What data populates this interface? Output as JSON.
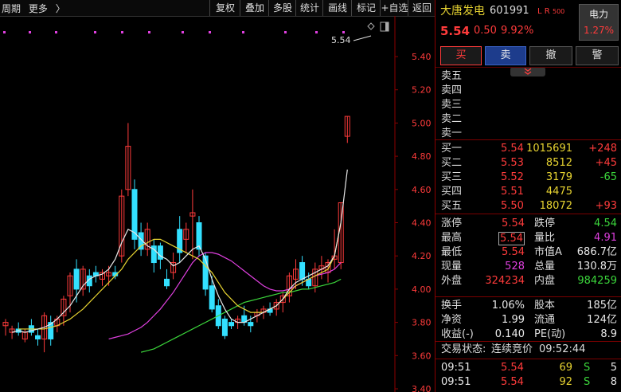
{
  "toolbar": {
    "period": "周期",
    "more": "更多",
    "more_arrow": "〉",
    "buttons": [
      "复权",
      "叠加",
      "多股",
      "统计",
      "画线",
      "标记",
      "+自选",
      "返回"
    ]
  },
  "chart_data": {
    "type": "candlestick",
    "ylim": [
      3.4,
      5.6
    ],
    "yticks": [
      "5.40",
      "5.20",
      "5.00",
      "4.80",
      "4.60",
      "4.40",
      "4.20",
      "4.00",
      "3.80",
      "3.60",
      "3.40"
    ],
    "annotation": "5.54",
    "candles": [
      [
        3.78,
        3.82,
        3.72,
        3.8
      ],
      [
        3.74,
        3.78,
        3.7,
        3.76
      ],
      [
        3.76,
        3.8,
        3.72,
        3.74
      ],
      [
        3.7,
        3.76,
        3.68,
        3.74
      ],
      [
        3.78,
        3.82,
        3.72,
        3.74
      ],
      [
        3.72,
        3.76,
        3.66,
        3.7
      ],
      [
        3.7,
        3.86,
        3.62,
        3.84
      ],
      [
        3.8,
        3.84,
        3.66,
        3.7
      ],
      [
        3.78,
        3.84,
        3.74,
        3.82
      ],
      [
        3.84,
        3.96,
        3.78,
        3.94
      ],
      [
        3.96,
        4.1,
        3.86,
        4.08
      ],
      [
        4.12,
        4.18,
        3.92,
        4.0
      ],
      [
        4.0,
        4.14,
        3.96,
        4.12
      ],
      [
        4.08,
        4.12,
        3.98,
        4.02
      ],
      [
        4.1,
        4.14,
        4.04,
        4.08
      ],
      [
        4.06,
        4.12,
        4.02,
        4.1
      ],
      [
        4.08,
        4.14,
        4.02,
        4.1
      ],
      [
        4.1,
        4.14,
        4.06,
        4.08
      ],
      [
        4.2,
        4.6,
        4.16,
        4.56
      ],
      [
        4.6,
        5.0,
        4.56,
        4.86
      ],
      [
        4.6,
        4.66,
        4.24,
        4.3
      ],
      [
        4.34,
        4.4,
        4.2,
        4.24
      ],
      [
        4.24,
        4.4,
        4.2,
        4.36
      ],
      [
        4.26,
        4.3,
        4.1,
        4.16
      ],
      [
        4.26,
        4.28,
        4.12,
        4.18
      ],
      [
        4.06,
        4.12,
        4.0,
        4.02
      ],
      [
        4.1,
        4.22,
        4.06,
        4.16
      ],
      [
        4.36,
        4.44,
        4.16,
        4.22
      ],
      [
        4.3,
        4.4,
        4.22,
        4.36
      ],
      [
        4.44,
        4.6,
        4.18,
        4.46
      ],
      [
        4.4,
        4.44,
        4.2,
        4.24
      ],
      [
        4.2,
        4.22,
        3.96,
        4.0
      ],
      [
        4.02,
        4.08,
        3.86,
        3.88
      ],
      [
        3.9,
        3.94,
        3.76,
        3.78
      ],
      [
        3.82,
        3.84,
        3.7,
        3.72
      ],
      [
        3.8,
        3.82,
        3.76,
        3.78
      ],
      [
        3.8,
        3.84,
        3.76,
        3.82
      ],
      [
        3.84,
        3.9,
        3.78,
        3.8
      ],
      [
        3.8,
        3.84,
        3.74,
        3.78
      ],
      [
        3.84,
        3.88,
        3.8,
        3.86
      ],
      [
        3.86,
        3.9,
        3.82,
        3.88
      ],
      [
        3.88,
        3.92,
        3.84,
        3.86
      ],
      [
        3.88,
        3.94,
        3.84,
        3.92
      ],
      [
        3.92,
        3.98,
        3.86,
        3.96
      ],
      [
        3.96,
        4.1,
        3.92,
        4.08
      ],
      [
        4.06,
        4.18,
        4.0,
        4.12
      ],
      [
        4.16,
        4.2,
        4.02,
        4.06
      ],
      [
        4.06,
        4.1,
        4.0,
        4.02
      ],
      [
        4.02,
        4.16,
        3.98,
        4.12
      ],
      [
        4.12,
        4.2,
        4.06,
        4.14
      ],
      [
        4.1,
        4.18,
        4.04,
        4.16
      ],
      [
        4.18,
        4.36,
        4.12,
        4.2
      ],
      [
        4.16,
        4.52,
        4.12,
        4.52
      ],
      [
        4.92,
        5.04,
        4.88,
        5.04
      ]
    ],
    "ma_white": [
      3.74,
      3.75,
      3.74,
      3.75,
      3.76,
      3.77,
      3.79,
      3.82,
      3.86,
      3.9,
      3.96,
      4.02,
      4.06,
      4.08,
      4.09,
      4.12,
      4.18,
      4.28,
      4.36,
      4.34,
      4.3,
      4.26,
      4.24,
      4.2,
      4.18,
      4.14,
      4.16,
      4.2,
      4.24,
      4.26,
      4.18,
      4.06,
      3.96,
      3.88,
      3.82,
      3.8,
      3.8,
      3.82,
      3.84,
      3.86,
      3.88,
      3.9,
      3.94,
      4.0,
      4.04,
      4.06,
      4.08,
      4.1,
      4.12,
      4.14,
      4.2,
      4.4,
      4.72
    ],
    "ma_yellow": [
      3.76,
      3.76,
      3.76,
      3.76,
      3.76,
      3.77,
      3.78,
      3.8,
      3.82,
      3.85,
      3.88,
      3.92,
      3.96,
      4.0,
      4.04,
      4.08,
      4.12,
      4.18,
      4.22,
      4.26,
      4.28,
      4.3,
      4.3,
      4.28,
      4.26,
      4.24,
      4.22,
      4.2,
      4.18,
      4.14,
      4.1,
      4.04,
      3.98,
      3.94,
      3.9,
      3.88,
      3.86,
      3.86,
      3.86,
      3.88,
      3.9,
      3.94,
      3.98,
      4.02,
      4.04,
      4.06,
      4.08,
      4.1,
      4.12,
      4.2,
      4.4
    ],
    "ma_magenta": [
      3.7,
      3.71,
      3.72,
      3.73,
      3.75,
      3.77,
      3.8,
      3.84,
      3.88,
      3.93,
      3.98,
      4.04,
      4.1,
      4.16,
      4.2,
      4.22,
      4.22,
      4.21,
      4.19,
      4.17,
      4.14,
      4.11,
      4.08,
      4.05,
      4.02,
      4.0,
      3.99,
      3.99,
      4.0,
      4.02,
      4.04,
      4.06,
      4.08,
      4.09,
      4.1,
      4.12,
      4.16
    ],
    "ma_green": [
      3.62,
      3.63,
      3.64,
      3.66,
      3.68,
      3.7,
      3.72,
      3.74,
      3.76,
      3.78,
      3.8,
      3.82,
      3.84,
      3.86,
      3.88,
      3.9,
      3.92,
      3.93,
      3.94,
      3.95,
      3.96,
      3.97,
      3.98,
      3.98,
      3.99,
      4.0,
      4.0,
      4.01,
      4.02,
      4.03,
      4.04,
      4.06
    ]
  },
  "stock": {
    "name": "大唐发电",
    "code": "601991",
    "tags": "L R",
    "tag_small": "500",
    "price": "5.54",
    "change": "0.50",
    "pct": "9.92%",
    "sector": "电力",
    "sector_pct": "1.27%"
  },
  "actions": {
    "buy": "买",
    "sell": "卖",
    "cancel": "撤",
    "alert": "警"
  },
  "collapse_icon": "chevron-double-down",
  "sell_levels": [
    "卖五",
    "卖四",
    "卖三",
    "卖二",
    "卖一"
  ],
  "buy_levels": [
    {
      "label": "买一",
      "price": "5.54",
      "vol": "1015691",
      "chg": "+248"
    },
    {
      "label": "买二",
      "price": "5.53",
      "vol": "8512",
      "chg": "+45"
    },
    {
      "label": "买三",
      "price": "5.52",
      "vol": "3179",
      "chg": "-65"
    },
    {
      "label": "买四",
      "price": "5.51",
      "vol": "4475",
      "chg": ""
    },
    {
      "label": "买五",
      "price": "5.50",
      "vol": "18072",
      "chg": "+93"
    }
  ],
  "stats": [
    {
      "l1": "涨停",
      "v1": "5.54",
      "l2": "跌停",
      "v2": "4.54"
    },
    {
      "l1": "最高",
      "v1": "5.54",
      "l2": "量比",
      "v2": "4.91"
    },
    {
      "l1": "最低",
      "v1": "5.54",
      "l2": "市值A",
      "v2": "686.7亿"
    },
    {
      "l1": "现量",
      "v1": "528",
      "l2": "总量",
      "v2": "130.8万"
    },
    {
      "l1": "外盘",
      "v1": "324234",
      "l2": "内盘",
      "v2": "984259"
    }
  ],
  "stats2": [
    {
      "l1": "换手",
      "v1": "1.06%",
      "l2": "股本",
      "v2": "185亿"
    },
    {
      "l1": "净资",
      "v1": "1.99",
      "l2": "流通",
      "v2": "124亿"
    },
    {
      "l1": "收益(-)",
      "v1": "0.140",
      "l2": "PE(动)",
      "v2": "8.9"
    }
  ],
  "status": {
    "label": "交易状态:",
    "value": "连续竞价",
    "time": "09:52:44"
  },
  "ticks": [
    {
      "time": "09:51",
      "price": "5.54",
      "vol": "69",
      "side": "S",
      "num": "5"
    },
    {
      "time": "09:51",
      "price": "5.54",
      "vol": "92",
      "side": "S",
      "num": "8"
    }
  ]
}
